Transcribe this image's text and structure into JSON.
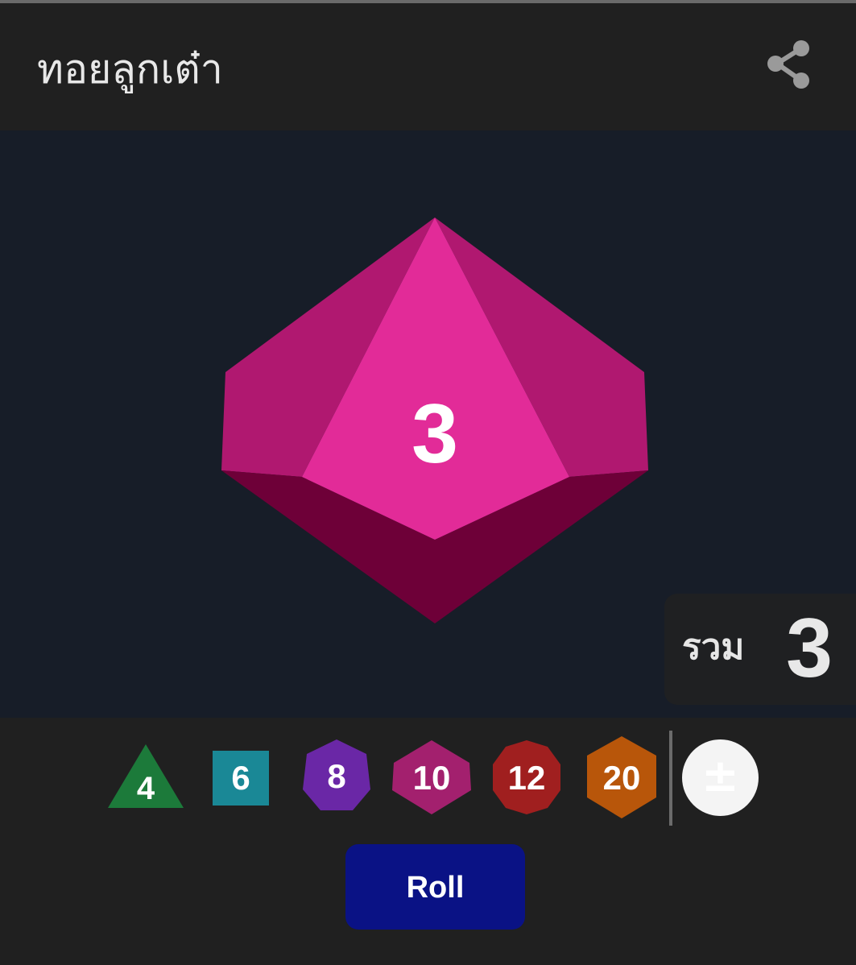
{
  "header": {
    "title": "ทอยลูกเต๋า",
    "share_icon": "share-icon"
  },
  "result": {
    "die_type": "d10",
    "face_value": "3",
    "die_color": "#e0289a"
  },
  "total": {
    "label": "รวม",
    "value": "3"
  },
  "dice_selector": [
    {
      "id": "d4",
      "label": "4",
      "shape": "triangle",
      "color": "#1c7a3a"
    },
    {
      "id": "d6",
      "label": "6",
      "shape": "square",
      "color": "#1a8896"
    },
    {
      "id": "d8",
      "label": "8",
      "shape": "octagon",
      "color": "#6a27a6"
    },
    {
      "id": "d10",
      "label": "10",
      "shape": "hexagon",
      "color": "#a3206e"
    },
    {
      "id": "d12",
      "label": "12",
      "shape": "decagon",
      "color": "#a01f1f"
    },
    {
      "id": "d20",
      "label": "20",
      "shape": "hexagon",
      "color": "#b8560a"
    }
  ],
  "modifier": {
    "glyph": "±",
    "icon": "plus-minus-icon"
  },
  "roll_button": {
    "label": "Roll",
    "color": "#0a1285"
  }
}
